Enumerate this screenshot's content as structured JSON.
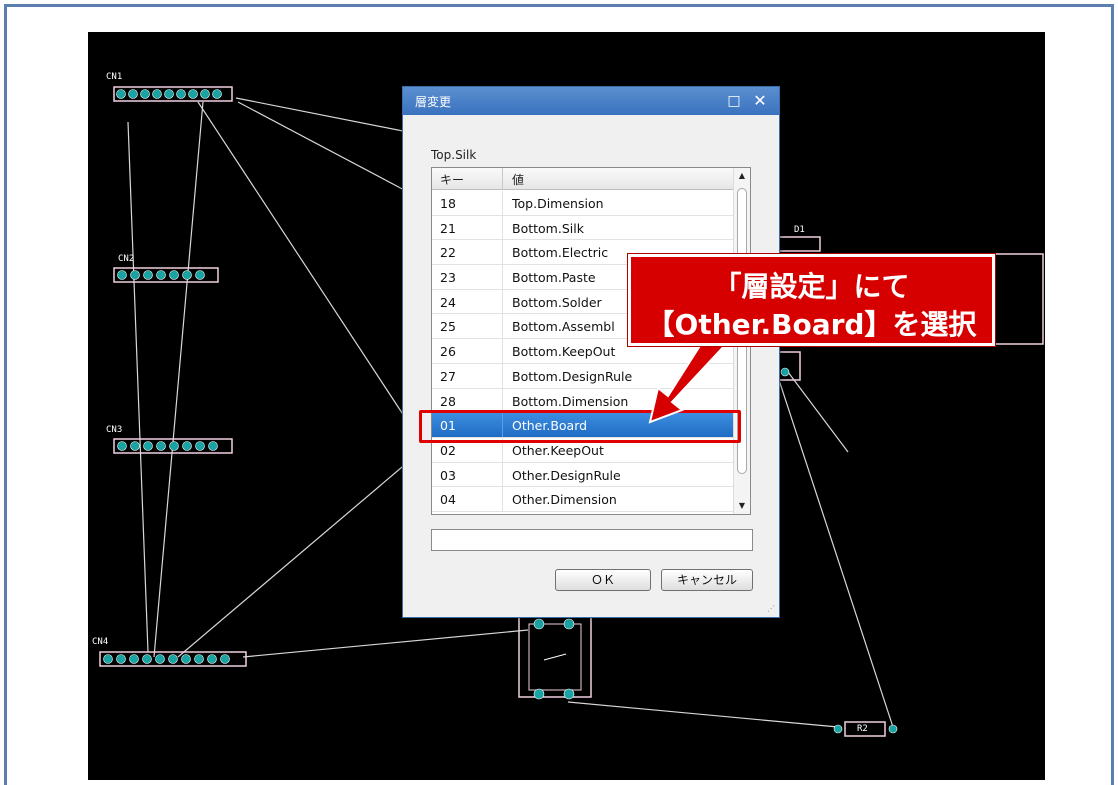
{
  "dialog": {
    "title": "層変更",
    "maximize_icon": "□",
    "close_icon": "✕",
    "current_layer": "Top.Silk",
    "columns": {
      "key": "キー",
      "value": "値"
    },
    "rows": [
      {
        "key": "18",
        "value": "Top.Dimension"
      },
      {
        "key": "21",
        "value": "Bottom.Silk"
      },
      {
        "key": "22",
        "value": "Bottom.Electric"
      },
      {
        "key": "23",
        "value": "Bottom.Paste"
      },
      {
        "key": "24",
        "value": "Bottom.Solder"
      },
      {
        "key": "25",
        "value": "Bottom.Assembl"
      },
      {
        "key": "26",
        "value": "Bottom.KeepOut"
      },
      {
        "key": "27",
        "value": "Bottom.DesignRule"
      },
      {
        "key": "28",
        "value": "Bottom.Dimension"
      },
      {
        "key": "01",
        "value": "Other.Board",
        "selected": true
      },
      {
        "key": "02",
        "value": "Other.KeepOut"
      },
      {
        "key": "03",
        "value": "Other.DesignRule"
      },
      {
        "key": "04",
        "value": "Other.Dimension"
      }
    ],
    "input_value": "",
    "ok_label": "ＯＫ",
    "cancel_label": "キャンセル"
  },
  "callout": {
    "line1": "「層設定」にて",
    "line2": "【Other.Board】を選択"
  },
  "pcb": {
    "labels": [
      "CN1",
      "CN2",
      "CN3",
      "CN4",
      "D1",
      "R2"
    ]
  },
  "colors": {
    "callout": "#d70000",
    "selection": "#2a7bd4",
    "frame": "#5b7fb0"
  }
}
